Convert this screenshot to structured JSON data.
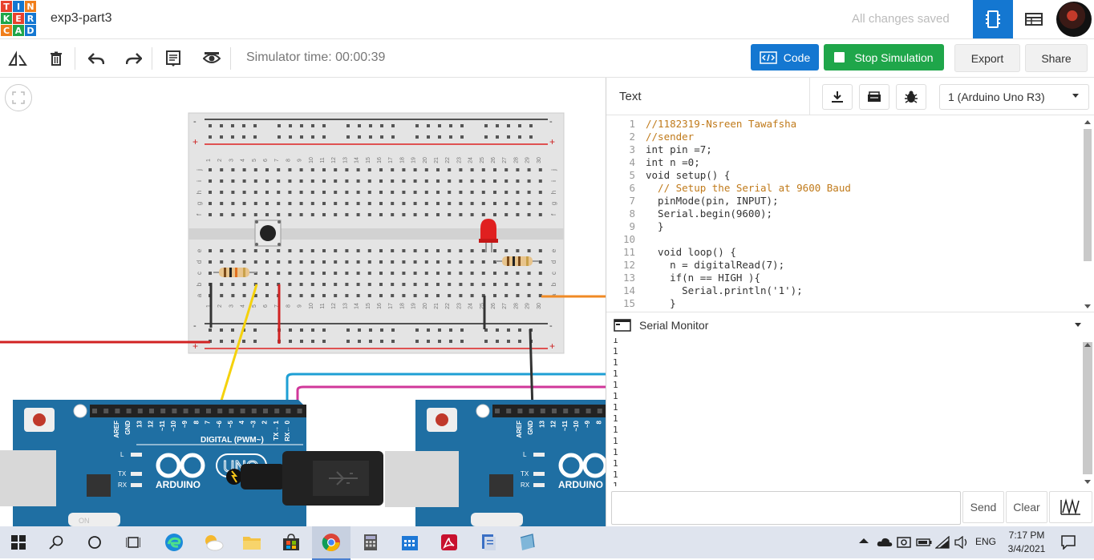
{
  "header": {
    "logo_letters": [
      "T",
      "I",
      "N",
      "K",
      "E",
      "R",
      "C",
      "A",
      "D"
    ],
    "logo_colors": [
      "#e8412c",
      "#1477d1",
      "#f07e1b",
      "#1fa64a",
      "#e8412c",
      "#1477d1",
      "#f07e1b",
      "#1fa64a",
      "#1477d1"
    ],
    "project_title": "exp3-part3",
    "save_status": "All changes saved",
    "views": [
      "circuit-view-icon",
      "component-list-icon"
    ],
    "avatar_icon": "user-avatar"
  },
  "toolbar": {
    "tools": [
      "rotate-icon",
      "trash-icon",
      "undo-icon",
      "redo-icon",
      "notes-icon",
      "visibility-icon"
    ],
    "simulator_time": "Simulator time: 00:00:39",
    "code_label": "Code",
    "stop_label": "Stop Simulation",
    "export_label": "Export",
    "share_label": "Share",
    "accent_blue": "#1477d1",
    "accent_green": "#1fa64a"
  },
  "breadboard": {
    "column_numbers": [
      "1",
      "2",
      "3",
      "4",
      "5",
      "6",
      "7",
      "8",
      "9",
      "10",
      "11",
      "12",
      "13",
      "14",
      "15",
      "16",
      "17",
      "18",
      "19",
      "20",
      "21",
      "22",
      "23",
      "24",
      "25",
      "26",
      "27",
      "28",
      "29",
      "30"
    ],
    "upper_row_letters": [
      "j",
      "i",
      "h",
      "g",
      "f"
    ],
    "lower_row_letters": [
      "e",
      "d",
      "c",
      "b",
      "a"
    ],
    "rail_plus": "+",
    "rail_minus": "-"
  },
  "arduino_left": {
    "header_labels": [
      "AREF",
      "GND",
      "13",
      "12",
      "~11",
      "~10",
      "~9",
      "8",
      "7",
      "~6",
      "~5",
      "4",
      "~3",
      "2",
      "TX→ 1",
      "RX← 0"
    ],
    "digital_label": "DIGITAL (PWM~)",
    "brand": "ARDUINO",
    "model": "UNO",
    "led_labels": [
      "L",
      "TX",
      "RX"
    ],
    "bottom_label": "ON"
  },
  "arduino_right": {
    "header_labels": [
      "AREF",
      "GND",
      "13",
      "12",
      "~11",
      "~10",
      "~9",
      "8"
    ],
    "brand": "ARDUINO",
    "led_labels": [
      "L",
      "TX",
      "RX"
    ]
  },
  "code_panel": {
    "mode_label": "Text",
    "download_icon": "download-icon",
    "upload_icon": "library-icon",
    "debug_icon": "bug-icon",
    "board_select": "1 (Arduino Uno R3)",
    "lines": [
      {
        "n": "1",
        "text": "//1182319-Nsreen Tawafsha",
        "kind": "cm"
      },
      {
        "n": "2",
        "text": "//sender",
        "kind": "cm"
      },
      {
        "n": "3",
        "text": "int pin =7;",
        "kind": "code"
      },
      {
        "n": "4",
        "text": "int n =0;",
        "kind": "code"
      },
      {
        "n": "5",
        "text": "void setup() {",
        "kind": "code"
      },
      {
        "n": "6",
        "text": "  // Setup the Serial at 9600 Baud",
        "kind": "cm"
      },
      {
        "n": "7",
        "text": "  pinMode(pin, INPUT);",
        "kind": "code"
      },
      {
        "n": "8",
        "text": "  Serial.begin(9600);",
        "kind": "code"
      },
      {
        "n": "9",
        "text": "  }",
        "kind": "code"
      },
      {
        "n": "10",
        "text": "",
        "kind": "code"
      },
      {
        "n": "11",
        "text": "  void loop() {",
        "kind": "code"
      },
      {
        "n": "12",
        "text": "    n = digitalRead(7);",
        "kind": "code"
      },
      {
        "n": "13",
        "text": "    if(n == HIGH ){",
        "kind": "code"
      },
      {
        "n": "14",
        "text": "      Serial.println('1');",
        "kind": "code"
      },
      {
        "n": "15",
        "text": "    }",
        "kind": "code"
      }
    ]
  },
  "serial_monitor": {
    "title": "Serial Monitor",
    "output": [
      "1",
      "1",
      "1",
      "1",
      "1",
      "1",
      "1",
      "1",
      "1",
      "1",
      "1",
      "1",
      "1",
      "1"
    ],
    "input_value": "",
    "send_label": "Send",
    "clear_label": "Clear",
    "graph_icon": "graph-icon"
  },
  "taskbar": {
    "apps": [
      "windows-start-icon",
      "search-icon",
      "cortana-icon",
      "task-view-icon",
      "edge-icon",
      "weather-icon",
      "file-explorer-icon",
      "store-icon",
      "chrome-icon",
      "calculator-icon",
      "calendar-icon",
      "acrobat-icon",
      "document-icon",
      "app-icon"
    ],
    "language": "ENG",
    "time": "7:17 PM",
    "date": "3/4/2021"
  }
}
